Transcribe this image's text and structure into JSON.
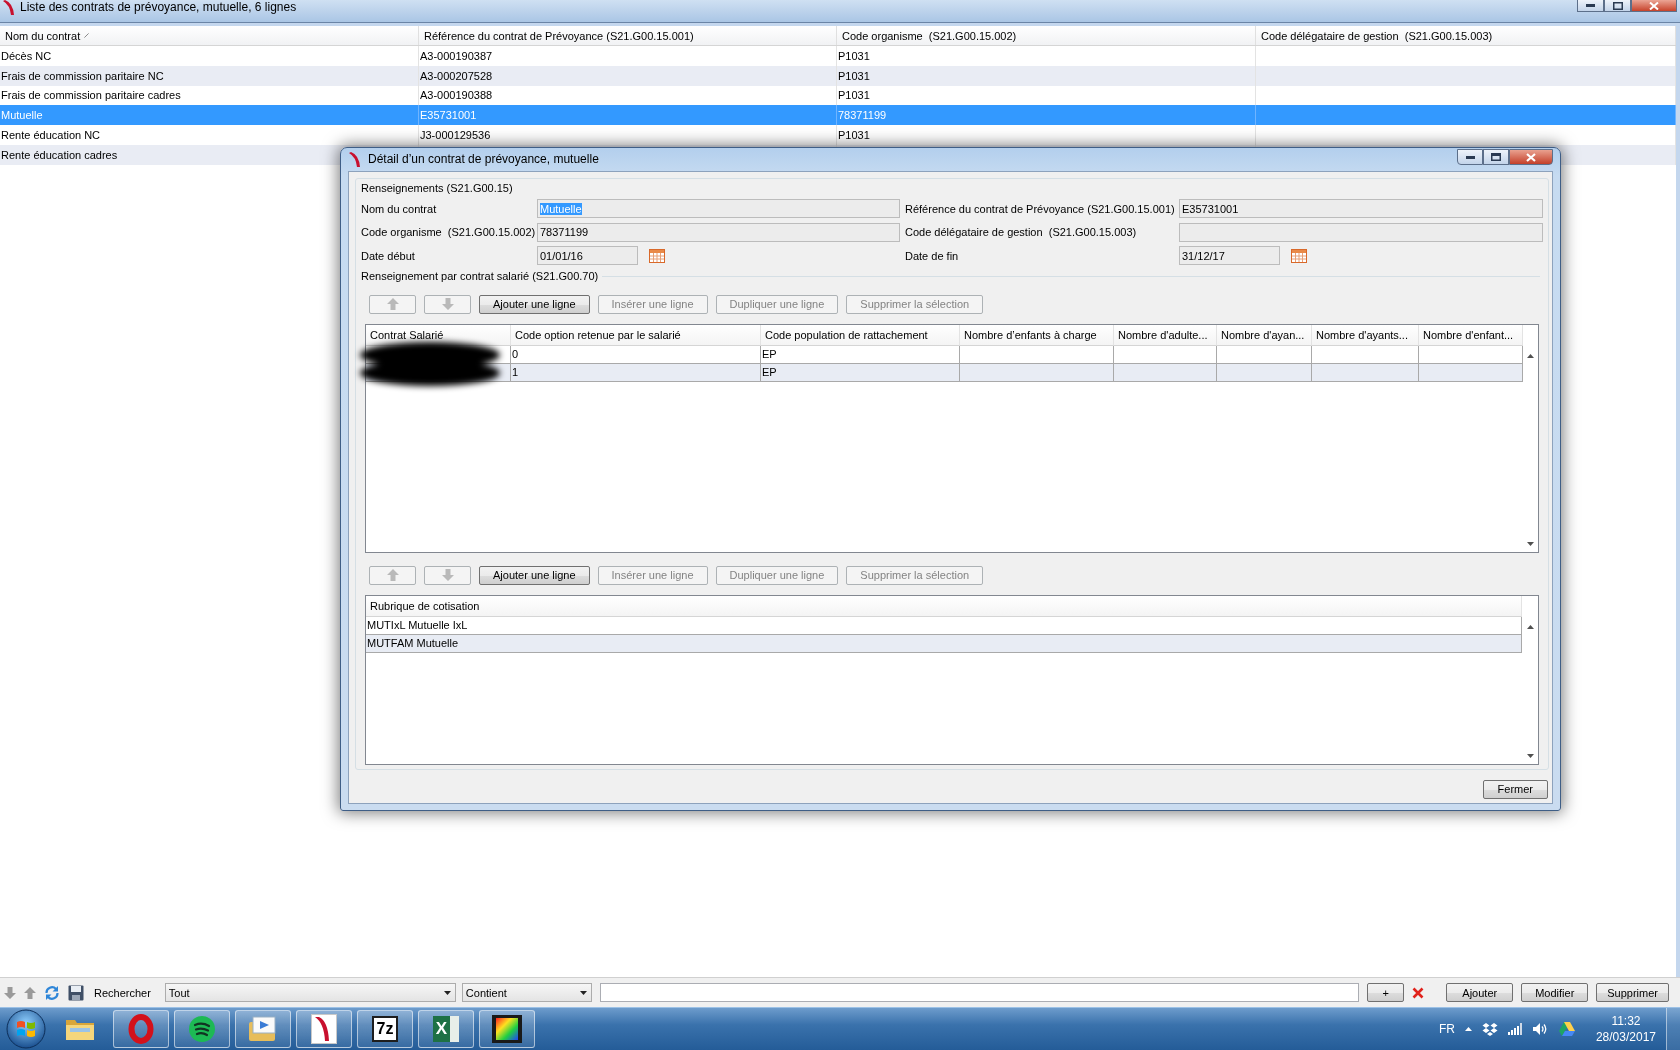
{
  "main_window": {
    "title": "Liste des contrats de prévoyance, mutuelle, 6 lignes"
  },
  "table": {
    "columns": [
      {
        "label": "Nom du contrat",
        "sorted": true
      },
      {
        "label": "Référence du contrat de Prévoyance (S21.G00.15.001)",
        "sorted": false
      },
      {
        "label": "Code organisme  (S21.G00.15.002)",
        "sorted": false
      },
      {
        "label": "Code délégataire de gestion  (S21.G00.15.003)",
        "sorted": false
      }
    ],
    "rows": [
      {
        "cells": [
          "Décès NC",
          "A3-000190387",
          "P1031"
        ],
        "selected": false
      },
      {
        "cells": [
          "Frais de commission paritaire NC",
          "A3-000207528",
          "P1031"
        ],
        "selected": false
      },
      {
        "cells": [
          "Frais de commission paritaire cadres",
          "A3-000190388",
          "P1031"
        ],
        "selected": false
      },
      {
        "cells": [
          "Mutuelle",
          "E35731001",
          "78371199"
        ],
        "selected": true
      },
      {
        "cells": [
          "Rente éducation NC",
          "J3-000129536",
          "P1031"
        ],
        "selected": false
      },
      {
        "cells": [
          "Rente éducation cadres"
        ],
        "selected": false
      }
    ]
  },
  "detail_dialog": {
    "title": "Détail d’un contrat de prévoyance, mutuelle",
    "group_title": "Renseignements (S21.G00.15)",
    "fields": [
      {
        "kind": "text",
        "label": "Nom du contrat",
        "value": "Mutuelle",
        "text_selected": true
      },
      {
        "kind": "text",
        "label": "Référence du contrat de Prévoyance (S21.G00.15.001)",
        "value": "E35731001",
        "text_selected": false
      },
      {
        "kind": "text",
        "label": "Code organisme  (S21.G00.15.002)",
        "value": "78371199",
        "text_selected": false
      },
      {
        "kind": "text",
        "label": "Code délégataire de gestion  (S21.G00.15.003)"
      },
      {
        "kind": "date",
        "label": "Date début",
        "value": "01/01/16"
      },
      {
        "kind": "date",
        "label": "Date de fin",
        "value": "31/12/17"
      }
    ],
    "section_title": "Renseignement par contrat salarié (S21.G00.70)",
    "toolbar_1": {
      "buttons": [
        {
          "kind": "up",
          "disabled": true
        },
        {
          "kind": "down",
          "disabled": true
        },
        {
          "kind": "text",
          "label": "Ajouter une ligne",
          "disabled": false
        },
        {
          "kind": "text",
          "label": "Insérer une ligne",
          "disabled": true
        },
        {
          "kind": "text",
          "label": "Dupliquer une ligne",
          "disabled": true
        },
        {
          "kind": "text",
          "label": "Supprimer la sélection",
          "disabled": true
        }
      ]
    },
    "salary_table": {
      "columns": [
        {
          "label": "Contrat Salarié"
        },
        {
          "label": "Code option retenue par le salarié"
        },
        {
          "label": "Code population de rattachement"
        },
        {
          "label": "Nombre d’enfants à charge"
        },
        {
          "label": "Nombre d'adulte..."
        },
        {
          "label": "Nombre d'ayan..."
        },
        {
          "label": "Nombre d'ayants..."
        },
        {
          "label": "Nombre d'enfant..."
        }
      ],
      "rows": [
        {
          "redacted": true,
          "cells": [
            null,
            "0",
            "EP"
          ]
        },
        {
          "redacted": true,
          "cells": [
            null,
            "1",
            "EP"
          ]
        }
      ]
    },
    "toolbar_2": {
      "buttons": [
        {
          "kind": "up",
          "disabled": true
        },
        {
          "kind": "down",
          "disabled": true
        },
        {
          "kind": "text",
          "label": "Ajouter une ligne",
          "disabled": false
        },
        {
          "kind": "text",
          "label": "Insérer une ligne",
          "disabled": true
        },
        {
          "kind": "text",
          "label": "Dupliquer une ligne",
          "disabled": true
        },
        {
          "kind": "text",
          "label": "Supprimer la sélection",
          "disabled": true
        }
      ]
    },
    "contribution_table": {
      "columns": [
        {
          "label": "Rubrique de cotisation"
        }
      ],
      "rows": [
        {
          "cells": [
            "MUTIxL Mutuelle IxL"
          ]
        },
        {
          "cells": [
            "MUTFAM Mutuelle"
          ]
        }
      ]
    },
    "close_button": "Fermer"
  },
  "bottom_toolbar": {
    "search_label": "Rechercher",
    "scope": "Tout",
    "operator": "Contient",
    "add_criterion": "+",
    "buttons": [
      "Ajouter",
      "Modifier",
      "Supprimer"
    ]
  },
  "taskbar": {
    "apps": [
      {
        "kind": "folder",
        "running": false
      },
      {
        "kind": "ring",
        "running": true
      },
      {
        "kind": "waves",
        "running": true
      },
      {
        "kind": "media",
        "running": true
      },
      {
        "kind": "swoosh",
        "running": true
      },
      {
        "kind": "archive",
        "label": "7z",
        "running": true
      },
      {
        "kind": "spreadsheet",
        "label": "X",
        "running": true
      },
      {
        "kind": "gradient",
        "running": true
      }
    ],
    "language": "FR",
    "time": "11:32",
    "date": "28/03/2017"
  }
}
